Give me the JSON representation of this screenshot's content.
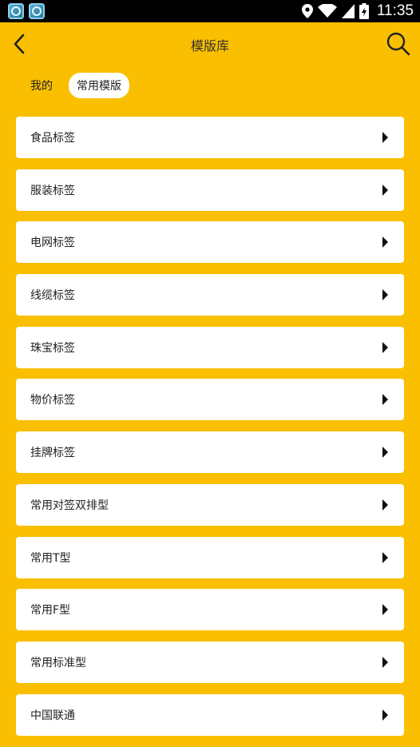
{
  "status_bar": {
    "time": "11:35",
    "icons": [
      "app-icon",
      "app-icon",
      "location-icon",
      "wifi-icon",
      "signal-icon",
      "battery-icon"
    ]
  },
  "header": {
    "title": "模版库",
    "back_icon": "chevron-left-icon",
    "search_icon": "search-icon"
  },
  "tabs": [
    {
      "label": "我的",
      "active": false
    },
    {
      "label": "常用模版",
      "active": true
    }
  ],
  "templates": [
    {
      "label": "食品标签"
    },
    {
      "label": "服装标签"
    },
    {
      "label": "电网标签"
    },
    {
      "label": "线缆标签"
    },
    {
      "label": "珠宝标签"
    },
    {
      "label": "物价标签"
    },
    {
      "label": "挂牌标签"
    },
    {
      "label": "常用对签双排型"
    },
    {
      "label": "常用T型"
    },
    {
      "label": "常用F型"
    },
    {
      "label": "常用标准型"
    },
    {
      "label": "中国联通"
    }
  ],
  "colors": {
    "background": "#F9BF00",
    "card": "#FFFFFF",
    "status_bar": "#000000"
  }
}
